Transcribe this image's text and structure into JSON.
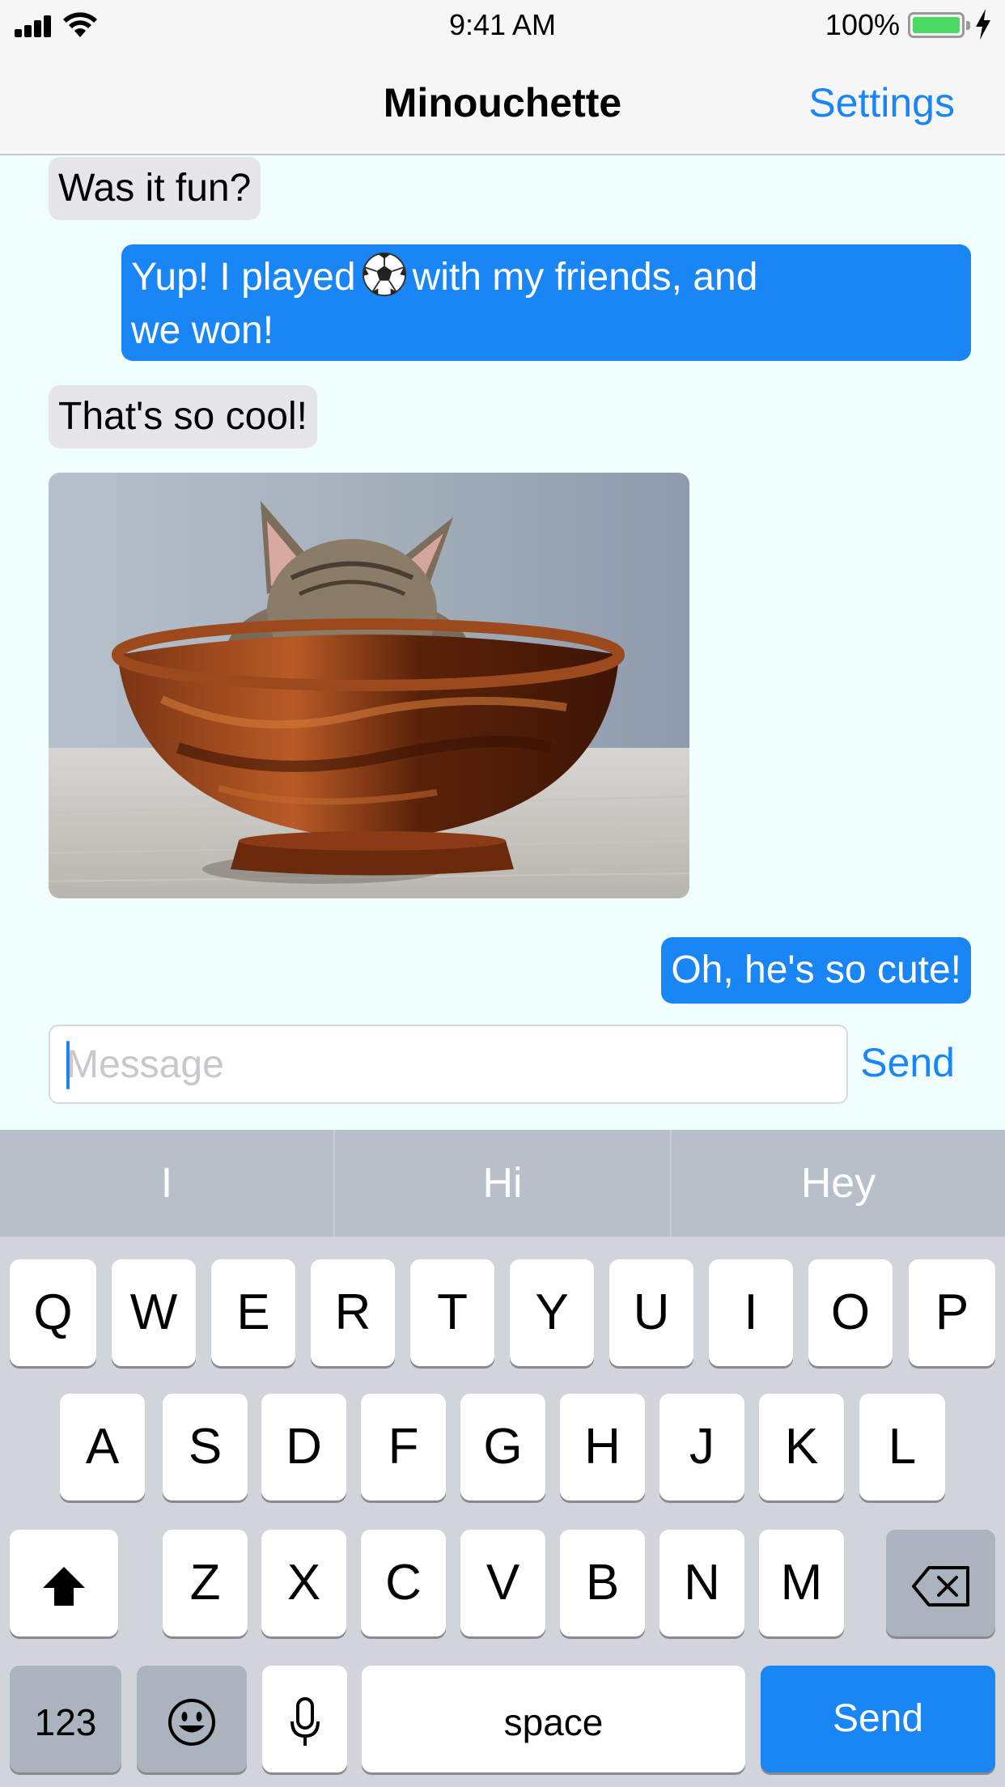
{
  "status_bar": {
    "time": "9:41 AM",
    "battery_percent": "100%",
    "battery_level": 1.0,
    "icons": [
      "signal-icon",
      "wifi-icon",
      "battery-icon",
      "charging-bolt-icon"
    ]
  },
  "nav": {
    "title": "Minouchette",
    "settings_label": "Settings"
  },
  "messages": [
    {
      "direction": "incoming",
      "text": "Was it fun?"
    },
    {
      "direction": "outgoing",
      "text_before": "Yup! I played",
      "emoji": "soccer-ball-icon",
      "text_after": "with my friends, and",
      "text_line2": "we won!"
    },
    {
      "direction": "incoming",
      "text": "That's so cool!"
    },
    {
      "direction": "incoming",
      "type": "image",
      "image": "kitten-in-wooden-bowl"
    },
    {
      "direction": "outgoing",
      "text": "Oh, he's so cute!"
    }
  ],
  "composer": {
    "placeholder": "Message",
    "value": "",
    "send_label": "Send"
  },
  "keyboard": {
    "suggestions": [
      "I",
      "Hi",
      "Hey"
    ],
    "row1": [
      "Q",
      "W",
      "E",
      "R",
      "T",
      "Y",
      "U",
      "I",
      "O",
      "P"
    ],
    "row2": [
      "A",
      "S",
      "D",
      "F",
      "G",
      "H",
      "J",
      "K",
      "L"
    ],
    "row3": [
      "Z",
      "X",
      "C",
      "V",
      "B",
      "N",
      "M"
    ],
    "numbers_label": "123",
    "space_label": "space",
    "return_label": "Send"
  },
  "colors": {
    "accent": "#1a85f5",
    "chat_background": "#f0fefe",
    "incoming_bubble": "#e5e5ea",
    "keyboard_background": "#d1d4da"
  }
}
